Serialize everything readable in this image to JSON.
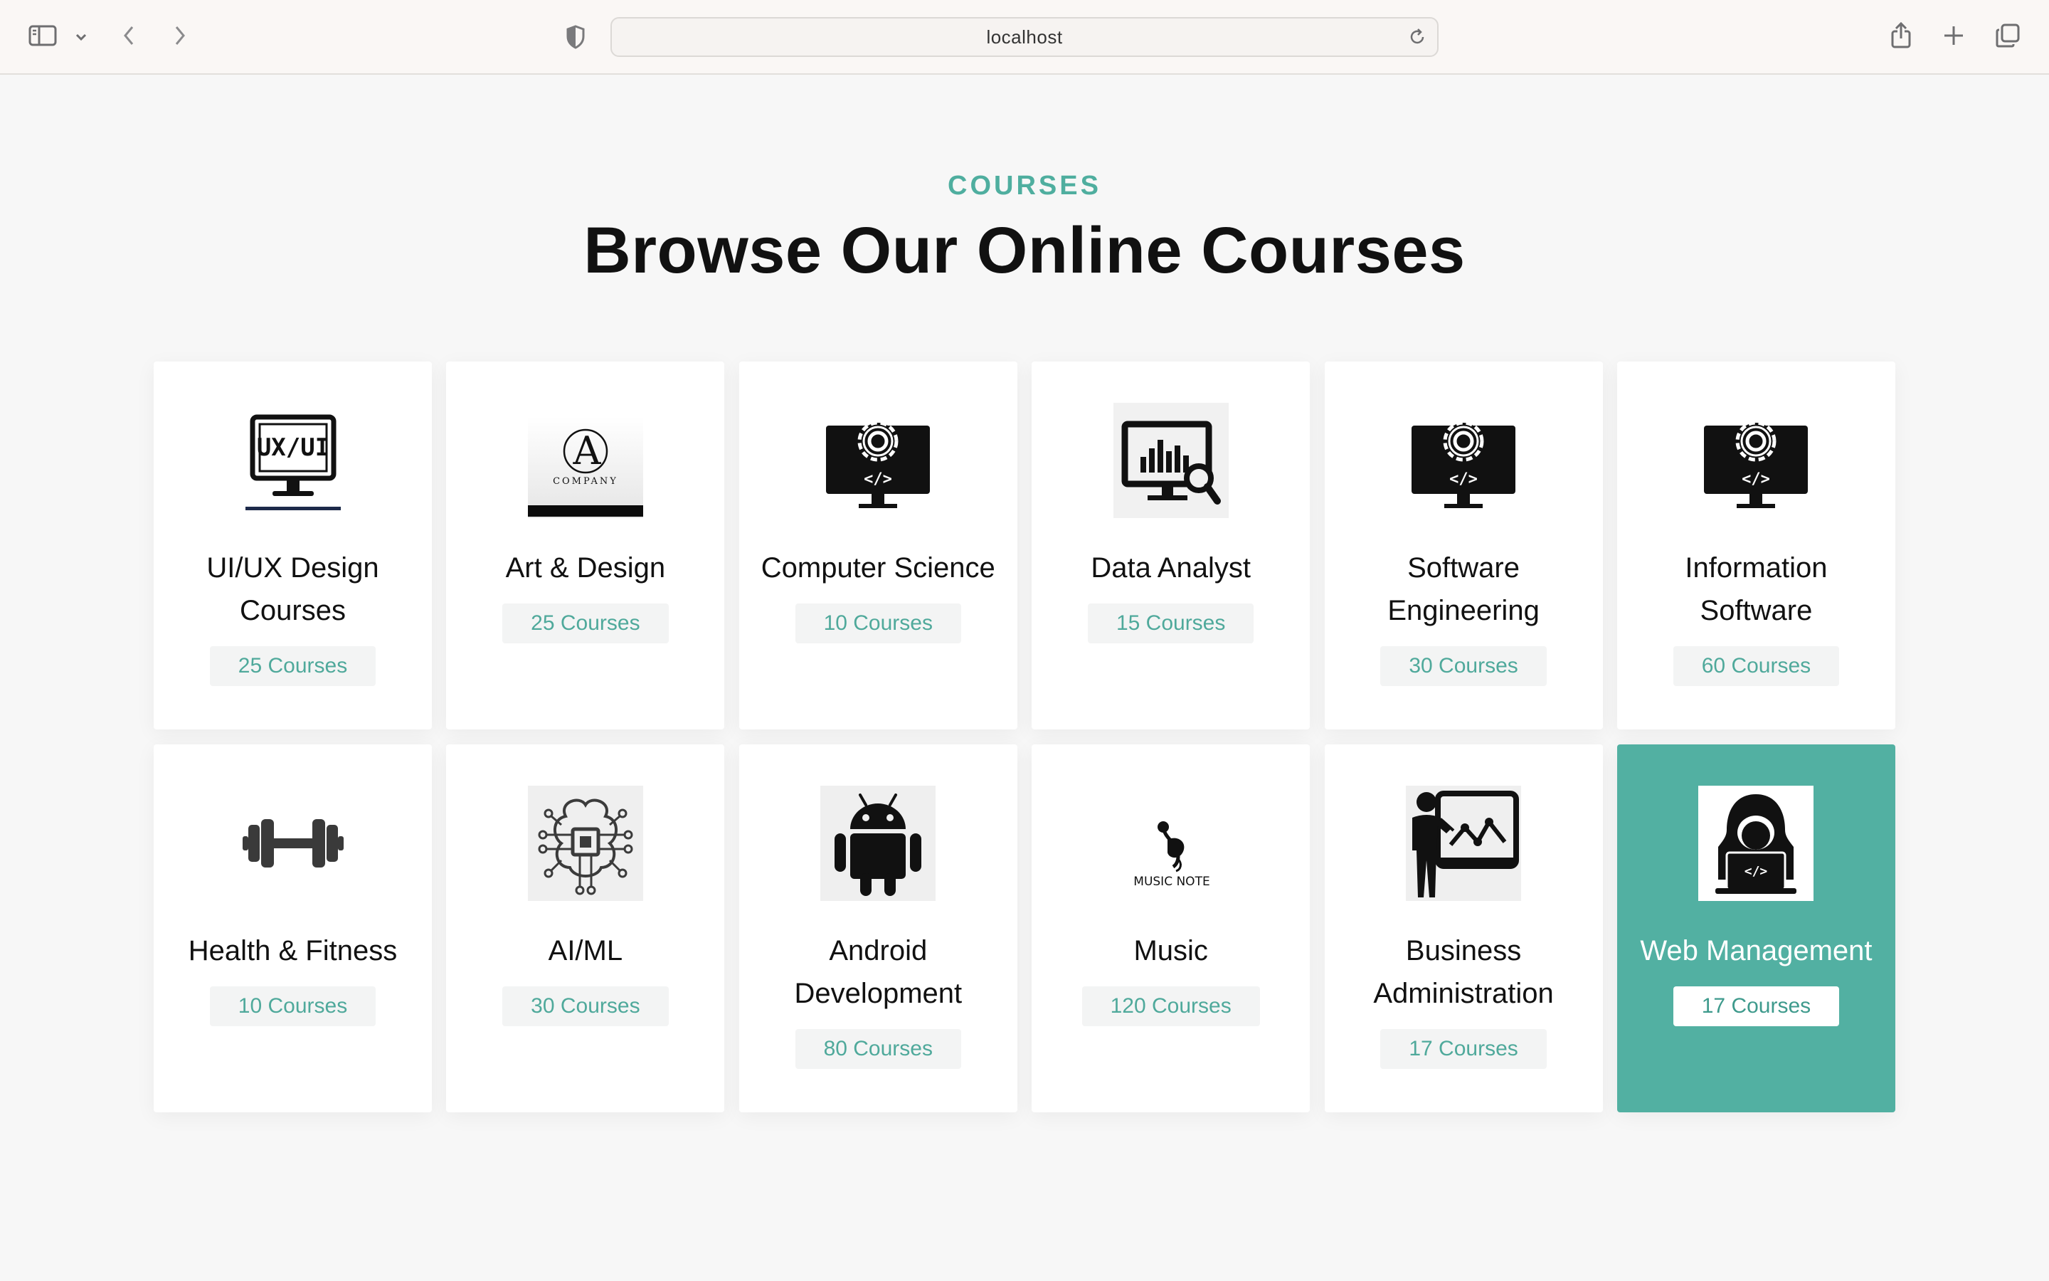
{
  "browser": {
    "url": "localhost"
  },
  "section": {
    "eyebrow": "COURSES",
    "title": "Browse Our Online Courses"
  },
  "colors": {
    "accent": "#52b0a2",
    "badge_bg": "#f3f4f4",
    "page_bg": "#f7f7f7"
  },
  "cards": [
    {
      "title": "UI/UX Design Courses",
      "count": "25 Courses",
      "icon": "ux-ui-monitor-icon",
      "active": false
    },
    {
      "title": "Art & Design",
      "count": "25 Courses",
      "icon": "company-logo-icon",
      "logo_letter": "A",
      "logo_text": "COMPANY",
      "active": false
    },
    {
      "title": "Computer Science",
      "count": "10 Courses",
      "icon": "monitor-gear-code-icon",
      "active": false
    },
    {
      "title": "Data Analyst",
      "count": "15 Courses",
      "icon": "data-analysis-monitor-icon",
      "active": false
    },
    {
      "title": "Software Engineering",
      "count": "30 Courses",
      "icon": "monitor-gear-code-icon",
      "active": false
    },
    {
      "title": "Information Software",
      "count": "60 Courses",
      "icon": "monitor-gear-code-icon",
      "active": false
    },
    {
      "title": "Health & Fitness",
      "count": "10 Courses",
      "icon": "dumbbell-icon",
      "active": false
    },
    {
      "title": "AI/ML",
      "count": "30 Courses",
      "icon": "ai-chip-brain-icon",
      "active": false
    },
    {
      "title": "Android Development",
      "count": "80 Courses",
      "icon": "android-icon",
      "active": false
    },
    {
      "title": "Music",
      "count": "120 Courses",
      "icon": "music-note-logo-icon",
      "logo_text": "MUSIC NOTE",
      "active": false
    },
    {
      "title": "Business Administration",
      "count": "17 Courses",
      "icon": "presenter-board-icon",
      "active": false
    },
    {
      "title": "Web Management",
      "count": "17 Courses",
      "icon": "hacker-laptop-icon",
      "active": true
    }
  ]
}
